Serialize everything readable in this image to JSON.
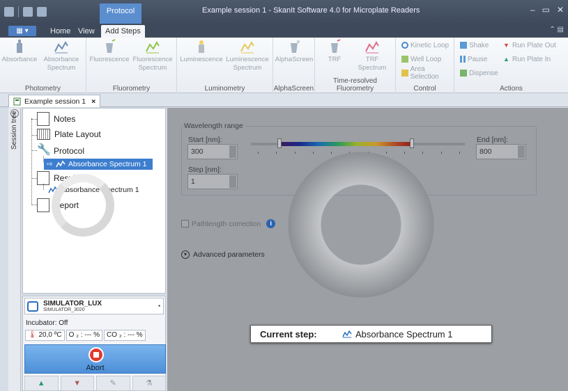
{
  "window": {
    "title": "Example session 1 - SkanIt Software 4.0 for Microplate Readers",
    "contextual_tab": "Protocol"
  },
  "ribbon_tabs": [
    "Home",
    "View",
    "Add Steps"
  ],
  "ribbon_groups": {
    "photometry": {
      "label": "Photometry",
      "buttons": [
        "Absorbance",
        "Absorbance Spectrum"
      ]
    },
    "fluorometry": {
      "label": "Fluorometry",
      "buttons": [
        "Fluorescence",
        "Fluorescence Spectrum"
      ]
    },
    "luminometry": {
      "label": "Luminometry",
      "buttons": [
        "Luminescence",
        "Luminescence Spectrum"
      ]
    },
    "alphascreen": {
      "label": "AlphaScreen",
      "buttons": [
        "AlphaScreen"
      ]
    },
    "trf": {
      "label": "Time-resolved Fluorometry",
      "buttons": [
        "TRF",
        "TRF Spectrum"
      ]
    },
    "control": {
      "label": "Control",
      "buttons": [
        "Kinetic Loop",
        "Well Loop",
        "Area Selection"
      ]
    },
    "actions": {
      "label": "Actions",
      "buttons": [
        "Shake",
        "Pause",
        "Dispense",
        "Run Plate Out",
        "Run Plate In"
      ]
    }
  },
  "document_tab": "Example session 1",
  "session_tree": {
    "label": "Session tree",
    "items": {
      "notes": "Notes",
      "plate_layout": "Plate Layout",
      "protocol": "Protocol",
      "protocol_step": "Absorbance Spectrum 1",
      "results": "Results",
      "results_step": "Absorbance Spectrum 1",
      "report": "Report"
    }
  },
  "instrument": {
    "name": "SIMULATOR_LUX",
    "id": "SIMULATOR_3020",
    "incubator": "Incubator: Off",
    "temperature": "20,0 ºC",
    "o2": "O ₂ : --- %",
    "co2": "CO ₂ : --- %",
    "abort_label": "Abort"
  },
  "wavelength": {
    "legend": "Wavelength range",
    "start_label": "Start [nm]:",
    "start_value": "300",
    "end_label": "End [nm]:",
    "end_value": "800",
    "step_label": "Step [nm]:",
    "step_value": "1"
  },
  "options": {
    "pathlength": "Pathlength correction",
    "advanced": "Advanced parameters"
  },
  "current_step": {
    "label": "Current step:",
    "value": "Absorbance Spectrum 1"
  },
  "icons": {
    "absorbance": "absorbance-icon",
    "spectrum": "spectrum-chart-icon",
    "stop": "stop-icon",
    "info": "info-icon"
  },
  "colors": {
    "accent": "#3d7ecf",
    "titlebar": "#4d5a6c",
    "abort": "#e23a2e"
  }
}
